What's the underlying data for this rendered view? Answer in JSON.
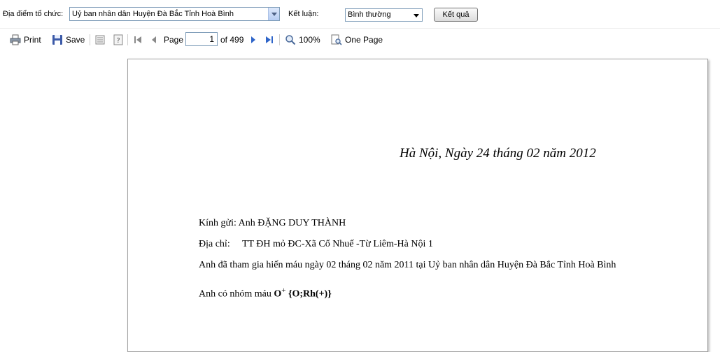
{
  "filters": {
    "location_label": "Địa điểm tổ chức:",
    "location_value": "Uỷ ban nhân dân Huyện Đà Bắc Tỉnh Hoà Bình",
    "conclusion_label": "Kết luận:",
    "conclusion_value": "Bình thường",
    "result_button": "Kết quả"
  },
  "toolbar": {
    "print_label": "Print",
    "save_label": "Save",
    "page_label": "Page",
    "page_value": "1",
    "page_of": "of 499",
    "zoom_label": "100%",
    "view_mode_label": "One Page"
  },
  "document": {
    "dateline": "Hà Nội, Ngày 24 tháng 02 năm 2012",
    "greeting": "Kính gửi: Anh ĐẶNG DUY THÀNH",
    "address": "Địa chỉ:     TT ĐH mỏ ĐC-Xã Cổ Nhuế -Từ Liêm-Hà Nội 1",
    "donation": "Anh đã tham gia hiến máu ngày 02 tháng 02 năm 2011 tại Uỷ ban nhân dân Huyện Đà Bắc Tỉnh Hoà Bình",
    "blood_prefix": "Anh có nhóm máu",
    "blood_group": "O",
    "blood_sign": "+",
    "blood_detail": "{O;Rh(+)}"
  }
}
